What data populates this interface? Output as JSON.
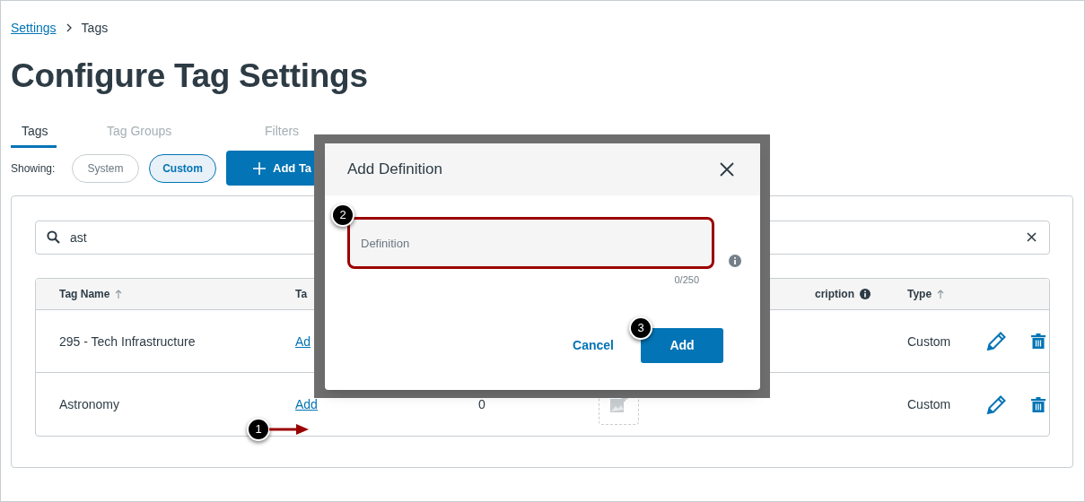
{
  "breadcrumb": [
    {
      "label": "Settings",
      "link": true
    },
    {
      "label": "Tags",
      "link": false
    }
  ],
  "title": "Configure Tag Settings",
  "tabs": [
    {
      "label": "Tags",
      "selected": true
    },
    {
      "label": "Tag Groups",
      "selected": false
    },
    {
      "label": "Filters",
      "selected": false
    }
  ],
  "showing": {
    "label": "Showing:",
    "options": [
      {
        "label": "System",
        "selected": false
      },
      {
        "label": "Custom",
        "selected": true
      }
    ]
  },
  "add_tag_button": "Add Ta",
  "search": {
    "value": "ast"
  },
  "table": {
    "columns": [
      {
        "label": "Tag Name",
        "kind": "sortable"
      },
      {
        "label": "Ta",
        "kind": "plain"
      },
      {
        "label": "cription",
        "kind": "info"
      },
      {
        "label": "Type",
        "kind": "sortable"
      }
    ],
    "rows": [
      {
        "kind": "covered",
        "name": "295 - Tech Infrastructure",
        "definition": "Ad",
        "type": "Custom"
      },
      {
        "kind": "full",
        "name": "Astronomy",
        "definition": "Add",
        "count": "0",
        "type": "Custom"
      }
    ]
  },
  "dialog": {
    "title": "Add Definition",
    "field": {
      "placeholder": "Definition",
      "highlighted": true
    },
    "counter": "0/250",
    "buttons": [
      {
        "label": "Cancel",
        "kind": "link"
      },
      {
        "label": "Add",
        "kind": "primary"
      }
    ]
  },
  "callouts": [
    {
      "number": "1",
      "arrow": true
    },
    {
      "number": "2",
      "arrow": false
    },
    {
      "number": "3",
      "arrow": false
    }
  ]
}
